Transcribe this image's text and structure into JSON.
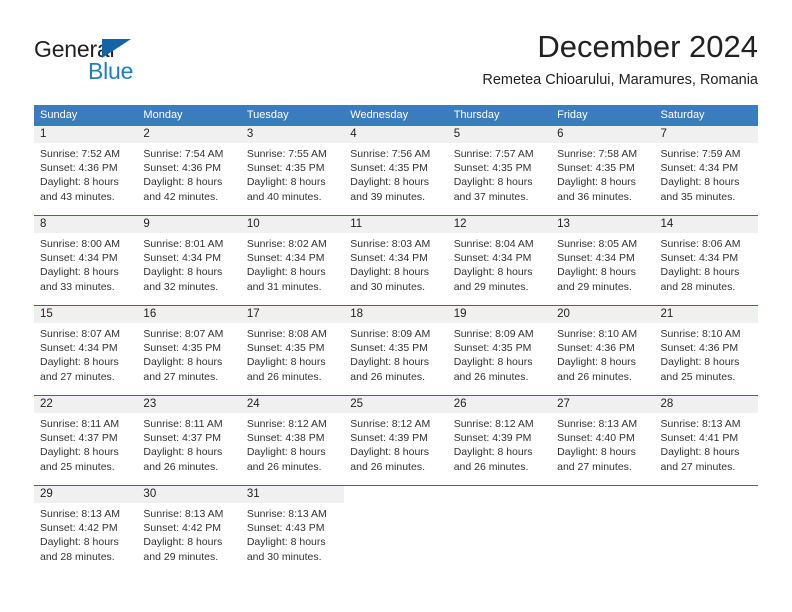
{
  "brand": {
    "name_part1": "General",
    "name_part2": "Blue",
    "triangle_icon": "triangle-icon",
    "accent_color": "#1f7fc4"
  },
  "header": {
    "title": "December 2024",
    "subtitle": "Remetea Chioarului, Maramures, Romania"
  },
  "calendar": {
    "header_background": "#3a7cbe",
    "row_separator_color": "#2b6ca8",
    "daynum_background": "#f0f0f0",
    "weekdays": [
      "Sunday",
      "Monday",
      "Tuesday",
      "Wednesday",
      "Thursday",
      "Friday",
      "Saturday"
    ],
    "weeks": [
      [
        {
          "day": "1",
          "sunrise": "Sunrise: 7:52 AM",
          "sunset": "Sunset: 4:36 PM",
          "daylight_line1": "Daylight: 8 hours",
          "daylight_line2": "and 43 minutes."
        },
        {
          "day": "2",
          "sunrise": "Sunrise: 7:54 AM",
          "sunset": "Sunset: 4:36 PM",
          "daylight_line1": "Daylight: 8 hours",
          "daylight_line2": "and 42 minutes."
        },
        {
          "day": "3",
          "sunrise": "Sunrise: 7:55 AM",
          "sunset": "Sunset: 4:35 PM",
          "daylight_line1": "Daylight: 8 hours",
          "daylight_line2": "and 40 minutes."
        },
        {
          "day": "4",
          "sunrise": "Sunrise: 7:56 AM",
          "sunset": "Sunset: 4:35 PM",
          "daylight_line1": "Daylight: 8 hours",
          "daylight_line2": "and 39 minutes."
        },
        {
          "day": "5",
          "sunrise": "Sunrise: 7:57 AM",
          "sunset": "Sunset: 4:35 PM",
          "daylight_line1": "Daylight: 8 hours",
          "daylight_line2": "and 37 minutes."
        },
        {
          "day": "6",
          "sunrise": "Sunrise: 7:58 AM",
          "sunset": "Sunset: 4:35 PM",
          "daylight_line1": "Daylight: 8 hours",
          "daylight_line2": "and 36 minutes."
        },
        {
          "day": "7",
          "sunrise": "Sunrise: 7:59 AM",
          "sunset": "Sunset: 4:34 PM",
          "daylight_line1": "Daylight: 8 hours",
          "daylight_line2": "and 35 minutes."
        }
      ],
      [
        {
          "day": "8",
          "sunrise": "Sunrise: 8:00 AM",
          "sunset": "Sunset: 4:34 PM",
          "daylight_line1": "Daylight: 8 hours",
          "daylight_line2": "and 33 minutes."
        },
        {
          "day": "9",
          "sunrise": "Sunrise: 8:01 AM",
          "sunset": "Sunset: 4:34 PM",
          "daylight_line1": "Daylight: 8 hours",
          "daylight_line2": "and 32 minutes."
        },
        {
          "day": "10",
          "sunrise": "Sunrise: 8:02 AM",
          "sunset": "Sunset: 4:34 PM",
          "daylight_line1": "Daylight: 8 hours",
          "daylight_line2": "and 31 minutes."
        },
        {
          "day": "11",
          "sunrise": "Sunrise: 8:03 AM",
          "sunset": "Sunset: 4:34 PM",
          "daylight_line1": "Daylight: 8 hours",
          "daylight_line2": "and 30 minutes."
        },
        {
          "day": "12",
          "sunrise": "Sunrise: 8:04 AM",
          "sunset": "Sunset: 4:34 PM",
          "daylight_line1": "Daylight: 8 hours",
          "daylight_line2": "and 29 minutes."
        },
        {
          "day": "13",
          "sunrise": "Sunrise: 8:05 AM",
          "sunset": "Sunset: 4:34 PM",
          "daylight_line1": "Daylight: 8 hours",
          "daylight_line2": "and 29 minutes."
        },
        {
          "day": "14",
          "sunrise": "Sunrise: 8:06 AM",
          "sunset": "Sunset: 4:34 PM",
          "daylight_line1": "Daylight: 8 hours",
          "daylight_line2": "and 28 minutes."
        }
      ],
      [
        {
          "day": "15",
          "sunrise": "Sunrise: 8:07 AM",
          "sunset": "Sunset: 4:34 PM",
          "daylight_line1": "Daylight: 8 hours",
          "daylight_line2": "and 27 minutes."
        },
        {
          "day": "16",
          "sunrise": "Sunrise: 8:07 AM",
          "sunset": "Sunset: 4:35 PM",
          "daylight_line1": "Daylight: 8 hours",
          "daylight_line2": "and 27 minutes."
        },
        {
          "day": "17",
          "sunrise": "Sunrise: 8:08 AM",
          "sunset": "Sunset: 4:35 PM",
          "daylight_line1": "Daylight: 8 hours",
          "daylight_line2": "and 26 minutes."
        },
        {
          "day": "18",
          "sunrise": "Sunrise: 8:09 AM",
          "sunset": "Sunset: 4:35 PM",
          "daylight_line1": "Daylight: 8 hours",
          "daylight_line2": "and 26 minutes."
        },
        {
          "day": "19",
          "sunrise": "Sunrise: 8:09 AM",
          "sunset": "Sunset: 4:35 PM",
          "daylight_line1": "Daylight: 8 hours",
          "daylight_line2": "and 26 minutes."
        },
        {
          "day": "20",
          "sunrise": "Sunrise: 8:10 AM",
          "sunset": "Sunset: 4:36 PM",
          "daylight_line1": "Daylight: 8 hours",
          "daylight_line2": "and 26 minutes."
        },
        {
          "day": "21",
          "sunrise": "Sunrise: 8:10 AM",
          "sunset": "Sunset: 4:36 PM",
          "daylight_line1": "Daylight: 8 hours",
          "daylight_line2": "and 25 minutes."
        }
      ],
      [
        {
          "day": "22",
          "sunrise": "Sunrise: 8:11 AM",
          "sunset": "Sunset: 4:37 PM",
          "daylight_line1": "Daylight: 8 hours",
          "daylight_line2": "and 25 minutes."
        },
        {
          "day": "23",
          "sunrise": "Sunrise: 8:11 AM",
          "sunset": "Sunset: 4:37 PM",
          "daylight_line1": "Daylight: 8 hours",
          "daylight_line2": "and 26 minutes."
        },
        {
          "day": "24",
          "sunrise": "Sunrise: 8:12 AM",
          "sunset": "Sunset: 4:38 PM",
          "daylight_line1": "Daylight: 8 hours",
          "daylight_line2": "and 26 minutes."
        },
        {
          "day": "25",
          "sunrise": "Sunrise: 8:12 AM",
          "sunset": "Sunset: 4:39 PM",
          "daylight_line1": "Daylight: 8 hours",
          "daylight_line2": "and 26 minutes."
        },
        {
          "day": "26",
          "sunrise": "Sunrise: 8:12 AM",
          "sunset": "Sunset: 4:39 PM",
          "daylight_line1": "Daylight: 8 hours",
          "daylight_line2": "and 26 minutes."
        },
        {
          "day": "27",
          "sunrise": "Sunrise: 8:13 AM",
          "sunset": "Sunset: 4:40 PM",
          "daylight_line1": "Daylight: 8 hours",
          "daylight_line2": "and 27 minutes."
        },
        {
          "day": "28",
          "sunrise": "Sunrise: 8:13 AM",
          "sunset": "Sunset: 4:41 PM",
          "daylight_line1": "Daylight: 8 hours",
          "daylight_line2": "and 27 minutes."
        }
      ],
      [
        {
          "day": "29",
          "sunrise": "Sunrise: 8:13 AM",
          "sunset": "Sunset: 4:42 PM",
          "daylight_line1": "Daylight: 8 hours",
          "daylight_line2": "and 28 minutes."
        },
        {
          "day": "30",
          "sunrise": "Sunrise: 8:13 AM",
          "sunset": "Sunset: 4:42 PM",
          "daylight_line1": "Daylight: 8 hours",
          "daylight_line2": "and 29 minutes."
        },
        {
          "day": "31",
          "sunrise": "Sunrise: 8:13 AM",
          "sunset": "Sunset: 4:43 PM",
          "daylight_line1": "Daylight: 8 hours",
          "daylight_line2": "and 30 minutes."
        },
        {
          "day": "",
          "sunrise": "",
          "sunset": "",
          "daylight_line1": "",
          "daylight_line2": ""
        },
        {
          "day": "",
          "sunrise": "",
          "sunset": "",
          "daylight_line1": "",
          "daylight_line2": ""
        },
        {
          "day": "",
          "sunrise": "",
          "sunset": "",
          "daylight_line1": "",
          "daylight_line2": ""
        },
        {
          "day": "",
          "sunrise": "",
          "sunset": "",
          "daylight_line1": "",
          "daylight_line2": ""
        }
      ]
    ]
  }
}
